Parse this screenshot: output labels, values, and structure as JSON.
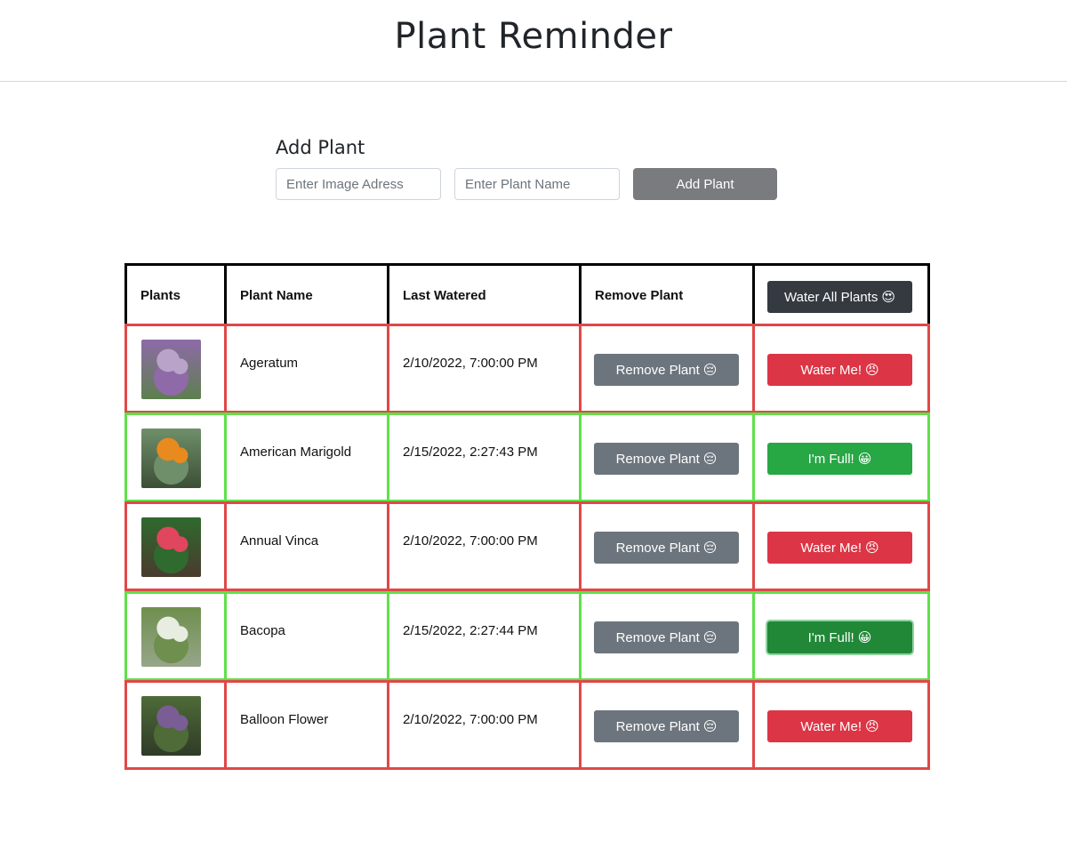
{
  "header": {
    "title": "Plant Reminder"
  },
  "add_plant": {
    "title": "Add Plant",
    "image_placeholder": "Enter Image Adress",
    "image_value": "",
    "name_placeholder": "Enter Plant Name",
    "name_value": "",
    "button_label": "Add Plant"
  },
  "table": {
    "headers": {
      "plants": "Plants",
      "plant_name": "Plant Name",
      "last_watered": "Last Watered",
      "remove_plant": "Remove Plant",
      "water_all": "Water All Plants",
      "water_all_emoji": "😍"
    },
    "remove_label": "Remove Plant",
    "remove_emoji": "😔",
    "rows": [
      {
        "name": "Ageratum",
        "last_watered": "2/10/2022, 7:00:00 PM",
        "status": "dry",
        "water_label": "Water Me!",
        "water_emoji": "😠",
        "thumb_colors": [
          "#b9a3c8",
          "#8e6aa8",
          "#5d7f4e"
        ]
      },
      {
        "name": "American Marigold",
        "last_watered": "2/15/2022, 2:27:43 PM",
        "status": "wet",
        "water_label": "I'm Full!",
        "water_emoji": "😀",
        "thumb_colors": [
          "#e88a1e",
          "#6f8f6a",
          "#3c4f36"
        ]
      },
      {
        "name": "Annual Vinca",
        "last_watered": "2/10/2022, 7:00:00 PM",
        "status": "dry",
        "water_label": "Water Me!",
        "water_emoji": "😠",
        "thumb_colors": [
          "#e0465d",
          "#2f6a2e",
          "#4a3b2e"
        ]
      },
      {
        "name": "Bacopa",
        "last_watered": "2/15/2022, 2:27:44 PM",
        "status": "wet",
        "water_label": "I'm Full!",
        "water_emoji": "😀",
        "thumb_colors": [
          "#e8ede2",
          "#6e8f4d",
          "#97a58a"
        ]
      },
      {
        "name": "Balloon Flower",
        "last_watered": "2/10/2022, 7:00:00 PM",
        "status": "dry",
        "water_label": "Water Me!",
        "water_emoji": "😠",
        "thumb_colors": [
          "#7b5d95",
          "#4e6b38",
          "#2f3b27"
        ]
      }
    ]
  },
  "colors": {
    "dry_border": "#e04848",
    "wet_border": "#5fe04a",
    "danger": "#dc3545",
    "success": "#28a745",
    "secondary": "#6c757d",
    "dark": "#343a40"
  }
}
